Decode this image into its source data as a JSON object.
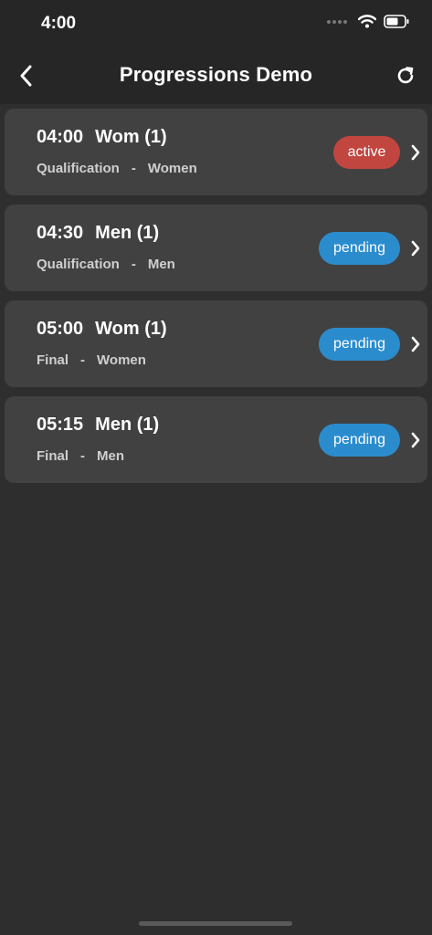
{
  "status": {
    "time": "4:00"
  },
  "nav": {
    "title": "Progressions Demo"
  },
  "items": [
    {
      "time": "04:00",
      "title": "Wom (1)",
      "phase": "Qualification",
      "separator": "-",
      "category": "Women",
      "status": "active"
    },
    {
      "time": "04:30",
      "title": "Men (1)",
      "phase": "Qualification",
      "separator": "-",
      "category": "Men",
      "status": "pending"
    },
    {
      "time": "05:00",
      "title": "Wom (1)",
      "phase": "Final",
      "separator": "-",
      "category": "Women",
      "status": "pending"
    },
    {
      "time": "05:15",
      "title": "Men (1)",
      "phase": "Final",
      "separator": "-",
      "category": "Men",
      "status": "pending"
    }
  ],
  "colors": {
    "active": "#c0463f",
    "pending": "#2b8ccd",
    "background": "#2e2e2e",
    "card": "#414141"
  },
  "icons": {
    "back": "chevron-left-icon",
    "refresh": "refresh-icon",
    "row": "chevron-right-icon"
  }
}
